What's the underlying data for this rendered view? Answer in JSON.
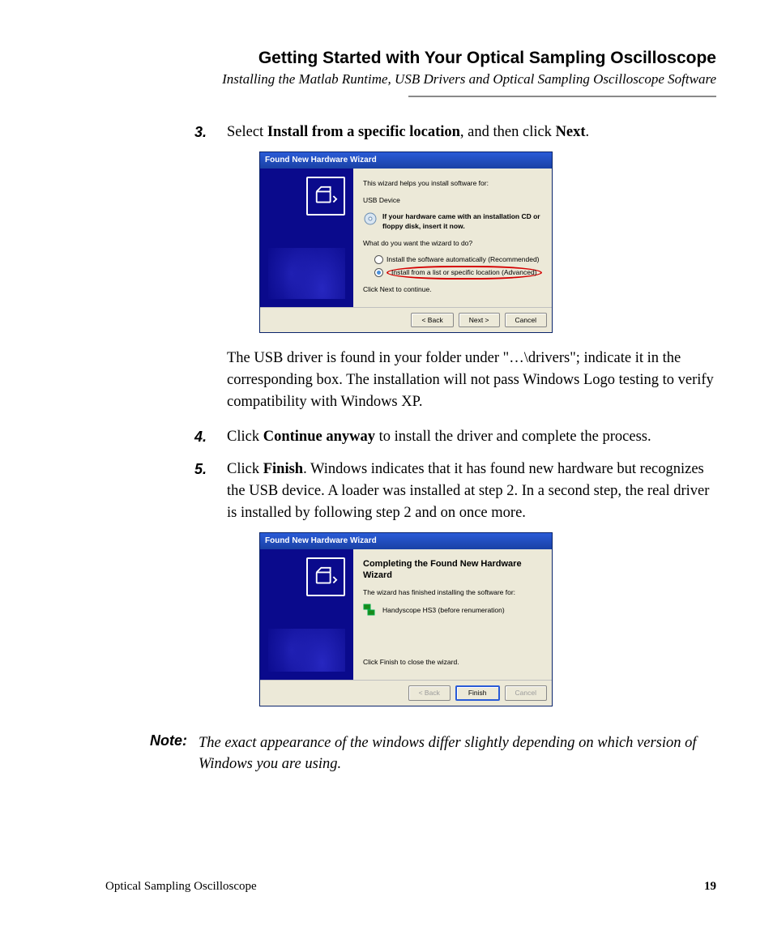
{
  "header": {
    "title": "Getting Started with Your Optical Sampling Oscilloscope",
    "subtitle": "Installing the Matlab Runtime, USB Drivers and Optical Sampling Oscilloscope Software"
  },
  "steps": {
    "s3": {
      "num": "3.",
      "pre": "Select ",
      "b1": "Install from a specific location",
      "mid": ", and then click ",
      "b2": "Next",
      "post": "."
    },
    "para_after3": "The USB driver is found in your folder under \"…\\drivers\"; indicate it in the corresponding box. The installation will not pass Windows Logo testing to verify compatibility with Windows XP.",
    "s4": {
      "num": "4.",
      "pre": "Click ",
      "b1": "Continue anyway",
      "post": " to install the driver and complete the process."
    },
    "s5": {
      "num": "5.",
      "pre": "Click ",
      "b1": "Finish",
      "post": ". Windows indicates that it has found new hardware but recognizes the USB device. A loader was installed at step 2. In a second step, the real driver is installed by following step 2 and on once more."
    }
  },
  "note": {
    "label": "Note:",
    "text": "The exact appearance of the windows differ slightly depending on which version of Windows you are using."
  },
  "dialog1": {
    "title": "Found New Hardware Wizard",
    "l1": "This wizard helps you install software for:",
    "device": "USB Device",
    "cd": "If your hardware came with an installation CD or floppy disk, insert it now.",
    "q": "What do you want the wizard to do?",
    "opt1": "Install the software automatically (Recommended)",
    "opt2": "Install from a list or specific location (Advanced)",
    "cont": "Click Next to continue.",
    "back": "< Back",
    "next": "Next >",
    "cancel": "Cancel"
  },
  "dialog2": {
    "title": "Found New Hardware Wizard",
    "h": "Completing the Found New Hardware Wizard",
    "l1": "The wizard has finished installing the software for:",
    "device": "Handyscope HS3 (before renumeration)",
    "close": "Click Finish to close the wizard.",
    "back": "< Back",
    "finish": "Finish",
    "cancel": "Cancel"
  },
  "footer": {
    "left": "Optical Sampling Oscilloscope",
    "page": "19"
  }
}
